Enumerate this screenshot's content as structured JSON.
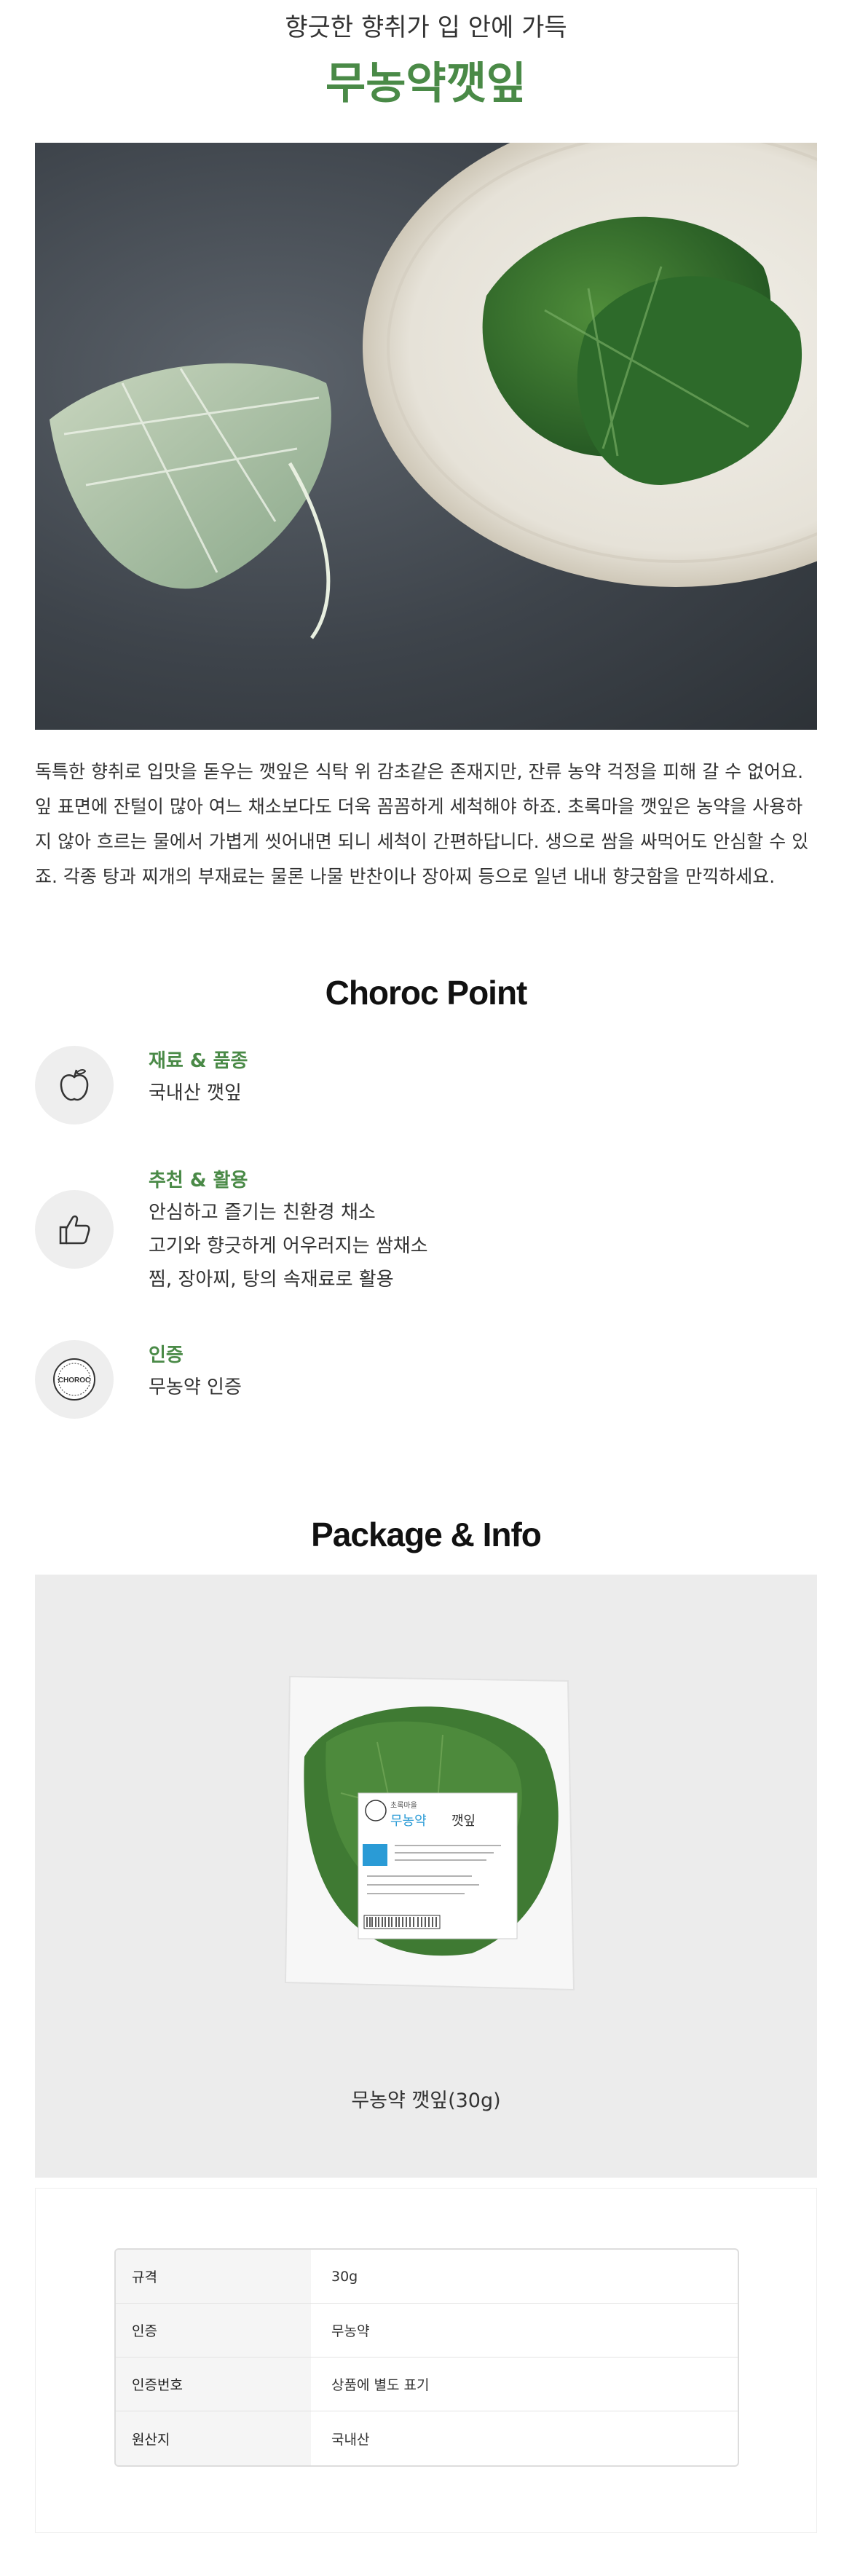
{
  "header": {
    "subtitle": "향긋한 향취가 입 안에 가득",
    "title": "무농약깻잎"
  },
  "description": "독특한 향취로 입맛을 돋우는 깻잎은 식탁 위 감초같은 존재지만, 잔류 농약 걱정을 피해 갈 수 없어요. 잎 표면에 잔털이 많아 여느 채소보다도 더욱 꼼꼼하게 세척해야 하죠. 초록마을 깻잎은 농약을 사용하지 않아 흐르는 물에서 가볍게 씻어내면 되니 세척이 간편하답니다. 생으로 쌈을 싸먹어도 안심할 수 있죠. 각종 탕과 찌개의 부재료는 물론 나물 반찬이나 장아찌 등으로 일년 내내 향긋함을 만끽하세요.",
  "points": {
    "heading": "Choroc Point",
    "items": [
      {
        "label": "재료 & 품종",
        "icon": "apple-icon",
        "lines": [
          "국내산 깻잎"
        ]
      },
      {
        "label": "추천 & 활용",
        "icon": "thumbs-up-icon",
        "lines": [
          "안심하고 즐기는 친환경 채소",
          "고기와 향긋하게 어우러지는 쌈채소",
          "찜, 장아찌, 탕의 속재료로 활용"
        ]
      },
      {
        "label": "인증",
        "icon": "choroc-badge-icon",
        "badge_text": "CHOROC",
        "lines": [
          "무농약 인증"
        ]
      }
    ]
  },
  "package": {
    "heading": "Package & Info",
    "caption": "무농약 깻잎(30g)",
    "label": {
      "brand": "초록마을",
      "tag": "무농약",
      "name": "깻잎"
    }
  },
  "info_table": [
    {
      "key": "규격",
      "value": "30g"
    },
    {
      "key": "인증",
      "value": "무농약"
    },
    {
      "key": "인증번호",
      "value": "상품에 별도 표기"
    },
    {
      "key": "원산지",
      "value": "국내산"
    }
  ],
  "colors": {
    "accent": "#4a8a47",
    "icon_bg": "#eeeeee",
    "package_bg": "#ececec"
  }
}
